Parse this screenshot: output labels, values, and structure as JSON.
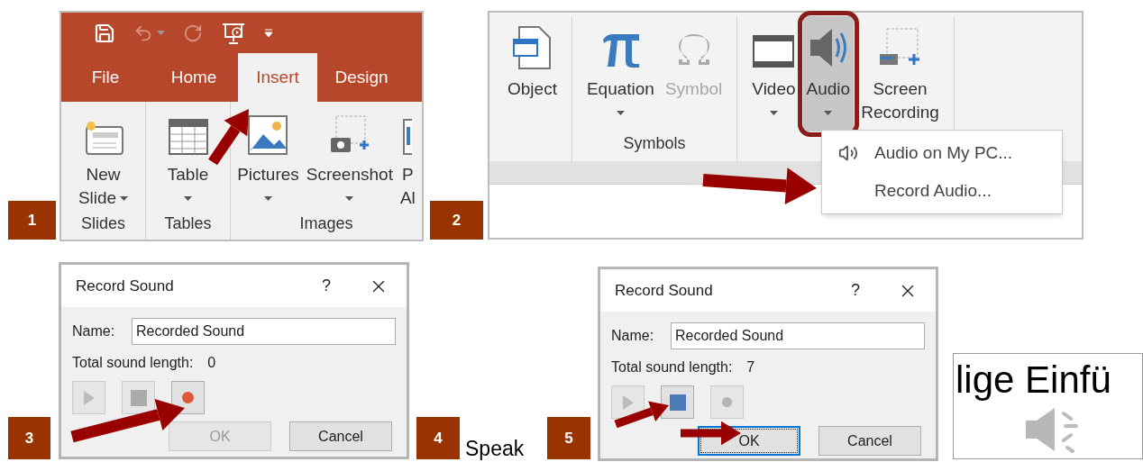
{
  "step_1": {
    "number": "1",
    "ribbon": {
      "tabs": [
        {
          "label": "File",
          "selected": false
        },
        {
          "label": "Home",
          "selected": false
        },
        {
          "label": "Insert",
          "selected": true
        },
        {
          "label": "Design",
          "selected": false
        }
      ],
      "groups": [
        {
          "label": "Slides",
          "items": [
            {
              "kind": "new-slide",
              "lines": [
                "New",
                "Slide"
              ],
              "dropdown": true
            }
          ]
        },
        {
          "label": "Tables",
          "items": [
            {
              "kind": "table",
              "lines": [
                "Table"
              ],
              "dropdown": true
            }
          ]
        },
        {
          "label": "Images",
          "items": [
            {
              "kind": "pictures",
              "lines": [
                "Pictures"
              ],
              "dropdown": true
            },
            {
              "kind": "screenshot",
              "lines": [
                "Screenshot"
              ],
              "dropdown": true
            },
            {
              "kind": "partial",
              "lines": [
                "P",
                "Al"
              ],
              "dropdown": false
            }
          ]
        }
      ]
    }
  },
  "step_2": {
    "number": "2",
    "ribbon": {
      "groups": [
        {
          "items": [
            {
              "kind": "object",
              "lines": [
                "Object"
              ],
              "dropdown": false,
              "selected": false,
              "disabled": false
            }
          ]
        },
        {
          "label": "Symbols",
          "items": [
            {
              "kind": "equation",
              "lines": [
                "Equation"
              ],
              "dropdown": true,
              "selected": false,
              "disabled": false
            },
            {
              "kind": "symbol",
              "lines": [
                "Symbol"
              ],
              "dropdown": false,
              "selected": false,
              "disabled": true
            }
          ]
        },
        {
          "items": [
            {
              "kind": "video",
              "lines": [
                "Video"
              ],
              "dropdown": true,
              "selected": false,
              "disabled": false
            },
            {
              "kind": "audio",
              "lines": [
                "Audio"
              ],
              "dropdown": true,
              "selected": true,
              "disabled": false
            },
            {
              "kind": "screen-recording",
              "lines": [
                "Screen",
                "Recording"
              ],
              "dropdown": false,
              "selected": false,
              "disabled": false
            }
          ]
        }
      ],
      "menu": [
        {
          "kind": "speaker",
          "label": "Audio on My PC..."
        },
        {
          "kind": "plain",
          "label": "Record Audio..."
        }
      ]
    }
  },
  "step_3": {
    "number": "3",
    "dialog": {
      "title": "Record Sound",
      "help": "?",
      "name_label": "Name:",
      "name_value": "Recorded Sound",
      "length_label": "Total sound length:",
      "length_value": "0",
      "controls": [
        {
          "kind": "play",
          "disabled": true
        },
        {
          "kind": "stop",
          "disabled": true
        },
        {
          "kind": "record",
          "disabled": false
        }
      ],
      "buttons": [
        {
          "label": "OK",
          "disabled": true,
          "focused": false
        },
        {
          "label": "Cancel",
          "disabled": false,
          "focused": false
        }
      ]
    }
  },
  "step_4": {
    "number": "4",
    "caption": "Speak"
  },
  "step_5": {
    "number": "5",
    "dialog": {
      "title": "Record Sound",
      "help": "?",
      "name_label": "Name:",
      "name_value": "Recorded Sound",
      "length_label": "Total sound length:",
      "length_value": "7",
      "controls": [
        {
          "kind": "play",
          "disabled": true
        },
        {
          "kind": "stop",
          "disabled": false
        },
        {
          "kind": "record",
          "disabled": true
        }
      ],
      "buttons": [
        {
          "label": "OK",
          "disabled": false,
          "focused": true
        },
        {
          "label": "Cancel",
          "disabled": false,
          "focused": false
        }
      ]
    },
    "slide_preview": {
      "text": "lige Einfü"
    }
  }
}
